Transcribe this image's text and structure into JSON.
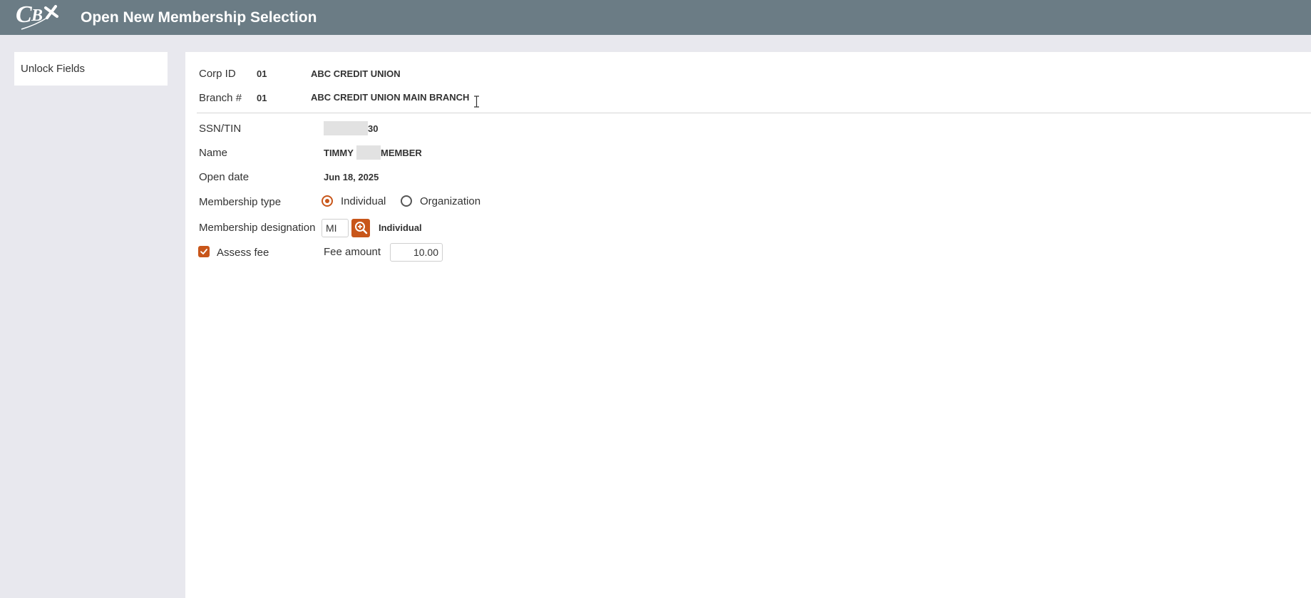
{
  "header": {
    "logo_text": "CBX",
    "title": "Open New Membership Selection"
  },
  "sidebar": {
    "unlock_fields_label": "Unlock Fields"
  },
  "colors": {
    "header_bg": "#6b7c85",
    "accent": "#c8561a",
    "page_bg": "#e8e8ee"
  },
  "form": {
    "corp": {
      "label": "Corp ID",
      "id": "01",
      "name": "ABC CREDIT UNION"
    },
    "branch": {
      "label": "Branch #",
      "id": "01",
      "name": "ABC CREDIT UNION MAIN BRANCH"
    },
    "ssn": {
      "label": "SSN/TIN",
      "visible_suffix": "30"
    },
    "name": {
      "label": "Name",
      "first": "TIMMY",
      "last": "MEMBER"
    },
    "open_date": {
      "label": "Open date",
      "value": "Jun 18, 2025"
    },
    "membership_type": {
      "label": "Membership type",
      "options": [
        "Individual",
        "Organization"
      ],
      "selected": "Individual"
    },
    "membership_designation": {
      "label": "Membership designation",
      "code": "MI",
      "description": "Individual",
      "lookup_icon": "zoom-in-icon"
    },
    "assess_fee": {
      "label": "Assess fee",
      "checked": true
    },
    "fee_amount": {
      "label": "Fee amount",
      "value": "10.00"
    }
  }
}
